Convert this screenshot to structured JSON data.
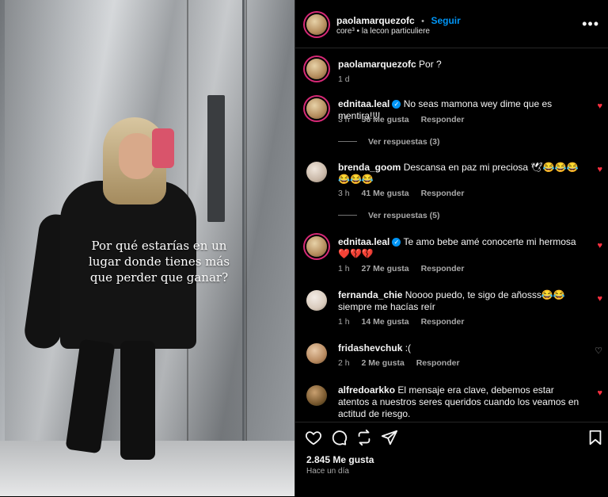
{
  "post": {
    "overlay_text": "Por qué estarías en un lugar donde tienes más que perder que ganar?"
  },
  "header": {
    "username": "paolamarquezofc",
    "separator": "•",
    "follow_label": "Seguir",
    "audio": "core³ • la lecon particuliere",
    "more_label": "•••"
  },
  "caption": {
    "username": "paolamarquezofc",
    "text": "Por ?",
    "time": "1 d"
  },
  "comments": [
    {
      "username": "ednitaa.leal",
      "verified": true,
      "text": "No seas mamona wey dime que es mentira!!!!",
      "time": "3 h",
      "likes": "56 Me gusta",
      "reply": "Responder",
      "liked": true,
      "view_replies": "Ver respuestas (3)"
    },
    {
      "username": "brenda_goom",
      "verified": false,
      "text": "Descansa en paz mi preciosa 🕊😂😂😂😂😂😂",
      "time": "3 h",
      "likes": "41 Me gusta",
      "reply": "Responder",
      "liked": true,
      "view_replies": "Ver respuestas (5)"
    },
    {
      "username": "ednitaa.leal",
      "verified": true,
      "text": "Te amo bebe amé conocerte mi hermosa ❤️💔💔",
      "time": "1 h",
      "likes": "27 Me gusta",
      "reply": "Responder",
      "liked": true
    },
    {
      "username": "fernanda_chie",
      "verified": false,
      "text": "Noooo puedo, te sigo de añosss😂😂siempre me hacías reír",
      "time": "1 h",
      "likes": "14 Me gusta",
      "reply": "Responder",
      "liked": true
    },
    {
      "username": "fridashevchuk",
      "verified": false,
      "text": ":(",
      "time": "2 h",
      "likes": "2 Me gusta",
      "reply": "Responder",
      "liked": false
    },
    {
      "username": "alfredoarkko",
      "verified": false,
      "text": "El mensaje era clave, debemos estar atentos a nuestros seres queridos cuando los veamos en actitud de riesgo.",
      "liked": true
    }
  ],
  "footer": {
    "likes": "2.845 Me gusta",
    "posted": "Hace un día"
  },
  "icons": {
    "heart_filled": "♥",
    "heart_empty": "♡",
    "verified": "✓"
  },
  "colors": {
    "accent": "#0095f6",
    "like_red": "#ff3040",
    "background": "#000000"
  }
}
